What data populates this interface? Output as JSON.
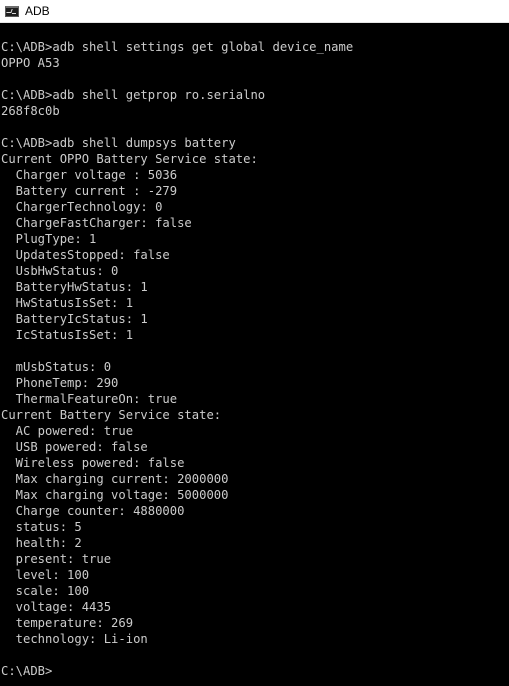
{
  "window": {
    "title": "ADB",
    "icon": "cmd-icon"
  },
  "console": {
    "lines": [
      "C:\\ADB>adb shell settings get global device_name",
      "OPPO A53",
      "",
      "C:\\ADB>adb shell getprop ro.serialno",
      "268f8c0b",
      "",
      "C:\\ADB>adb shell dumpsys battery",
      "Current OPPO Battery Service state:",
      "  Charger voltage : 5036",
      "  Battery current : -279",
      "  ChargerTechnology: 0",
      "  ChargeFastCharger: false",
      "  PlugType: 1",
      "  UpdatesStopped: false",
      "  UsbHwStatus: 0",
      "  BatteryHwStatus: 1",
      "  HwStatusIsSet: 1",
      "  BatteryIcStatus: 1",
      "  IcStatusIsSet: 1",
      "",
      "  mUsbStatus: 0",
      "  PhoneTemp: 290",
      "  ThermalFeatureOn: true",
      "Current Battery Service state:",
      "  AC powered: true",
      "  USB powered: false",
      "  Wireless powered: false",
      "  Max charging current: 2000000",
      "  Max charging voltage: 5000000",
      "  Charge counter: 4880000",
      "  status: 5",
      "  health: 2",
      "  present: true",
      "  level: 100",
      "  scale: 100",
      "  voltage: 4435",
      "  temperature: 269",
      "  technology: Li-ion",
      "",
      "C:\\ADB>"
    ]
  },
  "colors": {
    "background": "#000000",
    "text": "#cccccc",
    "titlebar": "#ffffff"
  }
}
